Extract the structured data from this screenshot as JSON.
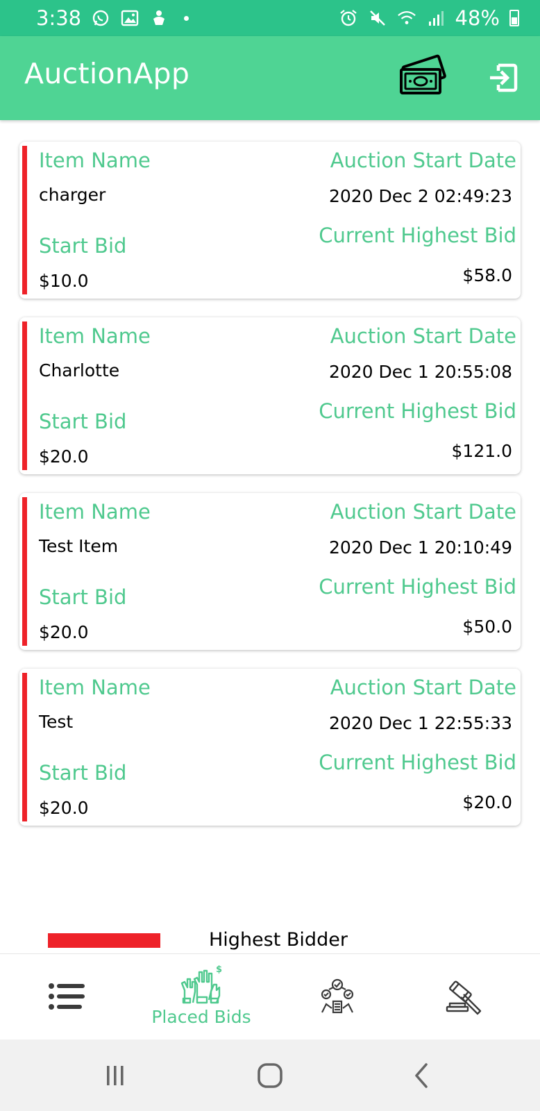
{
  "status_bar": {
    "time": "3:38",
    "battery": "48%",
    "left_icons": [
      "whatsapp-icon",
      "gallery-icon",
      "android-icon",
      "dot-icon"
    ],
    "right_icons": [
      "alarm-icon",
      "mute-icon",
      "wifi-icon",
      "signal-icon",
      "battery-icon"
    ],
    "color": "#2cc38a"
  },
  "app_bar": {
    "title": "AuctionApp",
    "color": "#4fd494",
    "actions": [
      "money-icon",
      "logout-icon"
    ]
  },
  "theme": {
    "label_color": "#4fc98e",
    "highlight_color": "#ee2229"
  },
  "labels": {
    "item_name": "Item Name",
    "auction_start_date": "Auction Start Date",
    "start_bid": "Start Bid",
    "current_highest_bid": "Current Highest Bid"
  },
  "items": [
    {
      "name": "charger",
      "start_date": "2020 Dec 2 02:49:23",
      "start_bid": "$10.0",
      "highest_bid": "$58.0"
    },
    {
      "name": "Charlotte",
      "start_date": "2020 Dec 1 20:55:08",
      "start_bid": "$20.0",
      "highest_bid": "$121.0"
    },
    {
      "name": "Test Item",
      "start_date": "2020 Dec 1 20:10:49",
      "start_bid": "$20.0",
      "highest_bid": "$50.0"
    },
    {
      "name": "Test",
      "start_date": "2020 Dec 1 22:55:33",
      "start_bid": "$20.0",
      "highest_bid": "$20.0"
    }
  ],
  "legend": {
    "label": "Highest Bidder"
  },
  "bottom_nav": {
    "items": [
      {
        "icon": "list-icon",
        "label": ""
      },
      {
        "icon": "raised-hands-icon",
        "label": "Placed Bids",
        "active": true
      },
      {
        "icon": "bidders-icon",
        "label": ""
      },
      {
        "icon": "gavel-icon",
        "label": ""
      }
    ]
  },
  "system_nav": {
    "buttons": [
      "recents-icon",
      "home-icon",
      "back-icon"
    ]
  }
}
